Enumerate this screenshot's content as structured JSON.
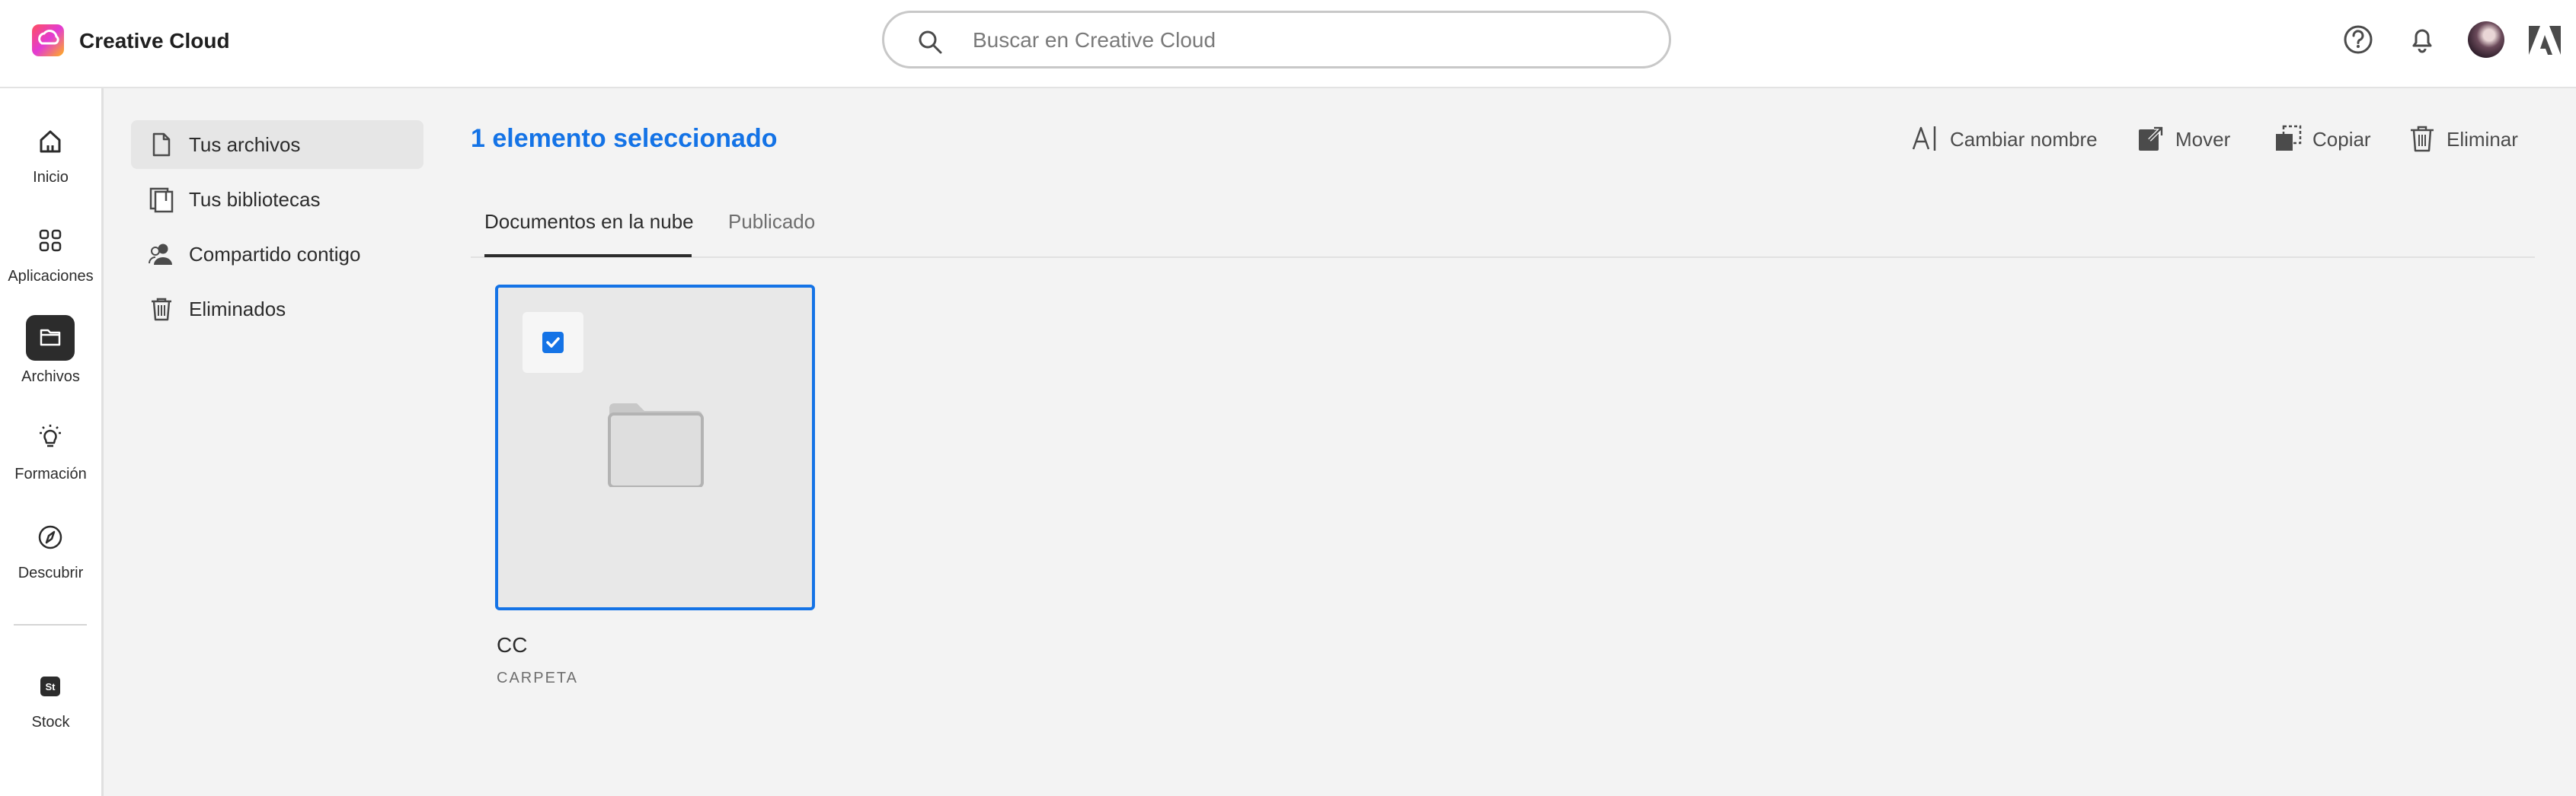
{
  "header": {
    "app_title": "Creative Cloud",
    "search_placeholder": "Buscar en Creative Cloud"
  },
  "rail": {
    "items": [
      {
        "label": "Inicio",
        "icon": "home-icon"
      },
      {
        "label": "Aplicaciones",
        "icon": "apps-grid-icon"
      },
      {
        "label": "Archivos",
        "icon": "folder-icon",
        "active": true
      },
      {
        "label": "Formación",
        "icon": "lightbulb-icon"
      },
      {
        "label": "Descubrir",
        "icon": "compass-icon"
      },
      {
        "label": "Stock",
        "icon": "stock-icon"
      }
    ]
  },
  "subnav": {
    "items": [
      {
        "label": "Tus archivos",
        "icon": "document-icon",
        "active": true
      },
      {
        "label": "Tus bibliotecas",
        "icon": "libraries-icon"
      },
      {
        "label": "Compartido contigo",
        "icon": "shared-user-icon"
      },
      {
        "label": "Eliminados",
        "icon": "trash-icon"
      }
    ]
  },
  "main": {
    "selection_title": "1 elemento seleccionado",
    "actions": {
      "rename": "Cambiar nombre",
      "move": "Mover",
      "copy": "Copiar",
      "delete": "Eliminar"
    },
    "tabs": [
      {
        "label": "Documentos en la nube",
        "active": true
      },
      {
        "label": "Publicado",
        "active": false
      }
    ],
    "items": [
      {
        "name": "CC",
        "type": "CARPETA",
        "selected": true
      }
    ]
  },
  "colors": {
    "accent": "#1473e6",
    "active_rail": "#2c2c2c"
  }
}
